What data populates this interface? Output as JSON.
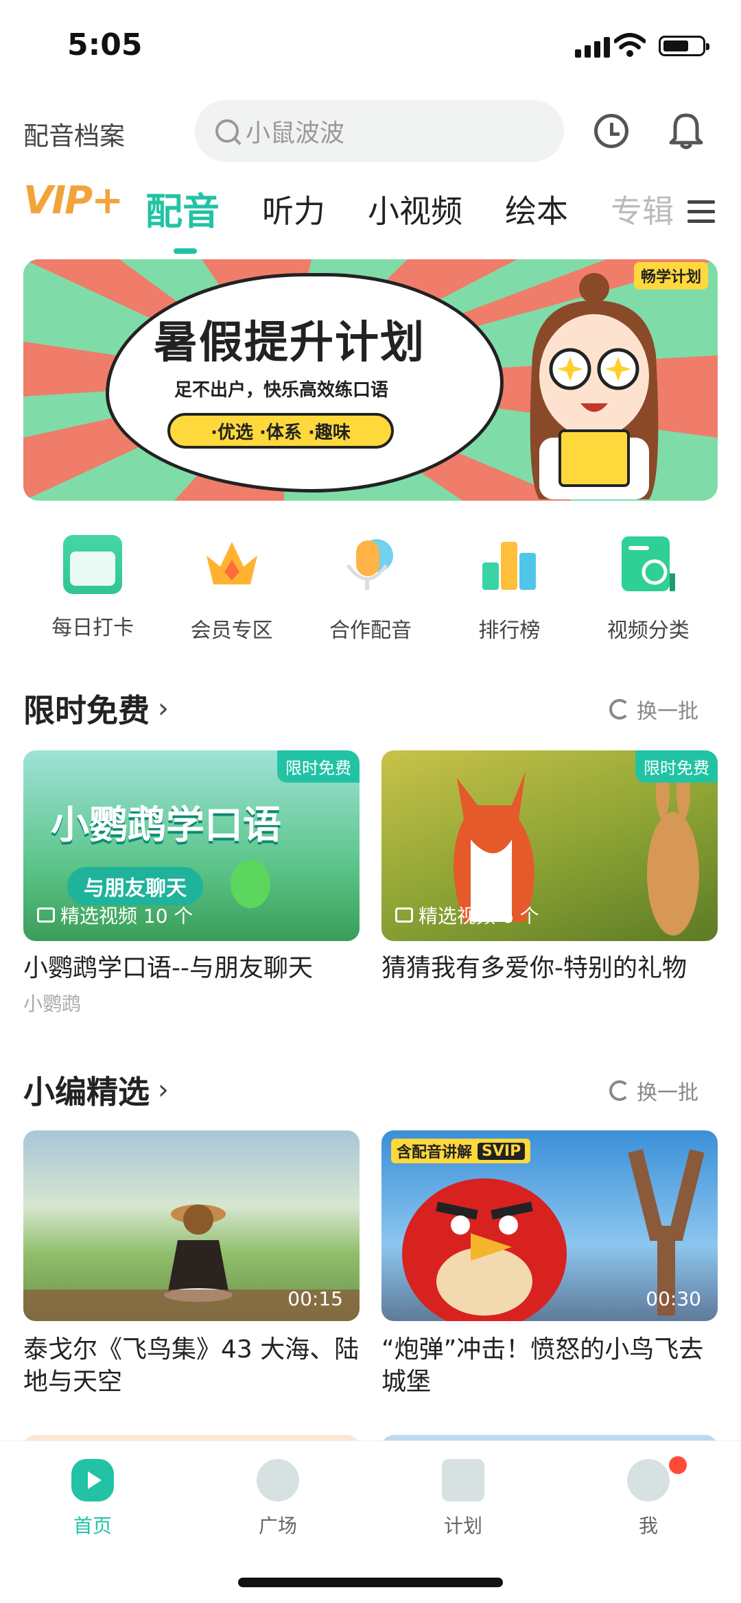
{
  "status_bar": {
    "time": "5:05"
  },
  "header": {
    "profile_link": "配音档案",
    "search_placeholder": "小鼠波波"
  },
  "tabs": {
    "vip": "VIP+",
    "items": [
      "配音",
      "听力",
      "小视频",
      "绘本",
      "专辑"
    ],
    "active_index": 0
  },
  "banner": {
    "title": "暑假提升计划",
    "subtitle": "足不出户，快乐高效练口语",
    "pill": "·优选 ·体系 ·趣味",
    "tag": "畅学计划"
  },
  "quick_menu": [
    {
      "label": "每日打卡",
      "icon": "calendar-icon",
      "color": "#44d6a8"
    },
    {
      "label": "会员专区",
      "icon": "crown-icon",
      "color": "#ffb331"
    },
    {
      "label": "合作配音",
      "icon": "microphone-icon",
      "color": "#ffb347"
    },
    {
      "label": "排行榜",
      "icon": "ranking-icon",
      "color": "#4fc6e8"
    },
    {
      "label": "视频分类",
      "icon": "category-icon",
      "color": "#2fcf95"
    }
  ],
  "section_free": {
    "title": "限时免费",
    "refresh": "换一批",
    "cards": [
      {
        "badge": "限时免费",
        "cover_title": "小鹦鹉学口语",
        "cover_pill": "与朋友聊天",
        "meta": "精选视频 10 个",
        "title": "小鹦鹉学口语--与朋友聊天",
        "author": "小鹦鹉"
      },
      {
        "badge": "限时免费",
        "meta": "精选视频 6 个",
        "title": "猜猜我有多爱你-特别的礼物",
        "author": ""
      }
    ]
  },
  "section_picks": {
    "title": "小编精选",
    "refresh": "换一批",
    "cards": [
      {
        "duration": "00:15",
        "title": "泰戈尔《飞鸟集》43 大海、陆地与天空"
      },
      {
        "duration": "00:30",
        "title": "“炮弹”冲击！愤怒的小鸟飞去城堡",
        "badge": "含配音讲解",
        "badge_svip": "SVIP"
      }
    ]
  },
  "bottom_nav": [
    {
      "label": "首页",
      "icon": "play-icon",
      "active": true
    },
    {
      "label": "广场",
      "icon": "chat-bubble-icon",
      "active": false
    },
    {
      "label": "计划",
      "icon": "book-icon",
      "active": false
    },
    {
      "label": "我",
      "icon": "profile-icon",
      "active": false,
      "notification": true
    }
  ],
  "colors": {
    "accent": "#22c3a4",
    "vip": "#f2a43a",
    "notification": "#ff4a3a"
  }
}
